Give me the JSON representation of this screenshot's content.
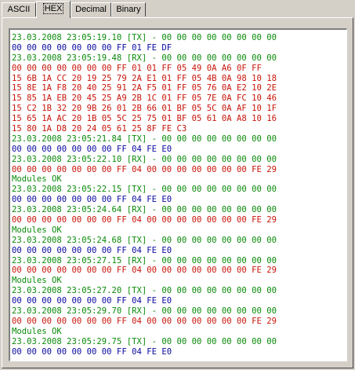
{
  "tabs": [
    {
      "label": "ASCII",
      "active": false
    },
    {
      "label": "HEX",
      "active": true
    },
    {
      "label": "Decimal",
      "active": false
    },
    {
      "label": "Binary",
      "active": false
    }
  ],
  "colors": {
    "tx_header": "#0a8a0a",
    "rx": "#c8140a",
    "tx_data": "#0a0aa0",
    "status_ok": "#0a8a0a"
  },
  "log_lines": [
    {
      "type": "tx",
      "text": "23.03.2008 23:05:19.10 [TX] - 00 00 00 00 00 00 00 00"
    },
    {
      "type": "txdata",
      "text": "00 00 00 00 00 00 00 FF 01 FE DF"
    },
    {
      "type": "tx",
      "text": "23.03.2008 23:05:19.48 [RX] - 00 00 00 00 00 00 00 00"
    },
    {
      "type": "rx",
      "text": "00 00 00 00 00 00 00 FF 01 01 FF 05 49 0A A6 0F FF"
    },
    {
      "type": "rx",
      "text": "15 6B 1A CC 20 19 25 79 2A E1 01 FF 05 4B 0A 98 10 18"
    },
    {
      "type": "rx",
      "text": "15 8E 1A F8 20 40 25 91 2A F5 01 FF 05 76 0A E2 10 2E"
    },
    {
      "type": "rx",
      "text": "15 85 1A EB 20 45 25 A9 2B 1C 01 FF 05 7E 0A FC 10 46"
    },
    {
      "type": "rx",
      "text": "15 C2 1B 32 20 9B 26 01 2B 66 01 BF 05 5C 0A AF 10 1F"
    },
    {
      "type": "rx",
      "text": "15 65 1A AC 20 1B 05 5C 25 75 01 BF 05 61 0A A8 10 16"
    },
    {
      "type": "rx",
      "text": "15 80 1A D8 20 24 05 61 25 8F FE C3"
    },
    {
      "type": "tx",
      "text": "23.03.2008 23:05:21.84 [TX] - 00 00 00 00 00 00 00 00"
    },
    {
      "type": "txdata",
      "text": "00 00 00 00 00 00 00 FF 04 FE E0"
    },
    {
      "type": "tx",
      "text": "23.03.2008 23:05:22.10 [RX] - 00 00 00 00 00 00 00 00"
    },
    {
      "type": "rx",
      "text": "00 00 00 00 00 00 00 FF 04 00 00 00 00 00 00 00 FE 29"
    },
    {
      "type": "ok",
      "text": "Modules OK"
    },
    {
      "type": "tx",
      "text": "23.03.2008 23:05:22.15 [TX] - 00 00 00 00 00 00 00 00"
    },
    {
      "type": "txdata",
      "text": "00 00 00 00 00 00 00 FF 04 FE E0"
    },
    {
      "type": "tx",
      "text": "23.03.2008 23:05:24.64 [RX] - 00 00 00 00 00 00 00 00"
    },
    {
      "type": "rx",
      "text": "00 00 00 00 00 00 00 FF 04 00 00 00 00 00 00 00 FE 29"
    },
    {
      "type": "ok",
      "text": "Modules OK"
    },
    {
      "type": "tx",
      "text": "23.03.2008 23:05:24.68 [TX] - 00 00 00 00 00 00 00 00"
    },
    {
      "type": "txdata",
      "text": "00 00 00 00 00 00 00 FF 04 FE E0"
    },
    {
      "type": "tx",
      "text": "23.03.2008 23:05:27.15 [RX] - 00 00 00 00 00 00 00 00"
    },
    {
      "type": "rx",
      "text": "00 00 00 00 00 00 00 FF 04 00 00 00 00 00 00 00 FE 29"
    },
    {
      "type": "ok",
      "text": "Modules OK"
    },
    {
      "type": "tx",
      "text": "23.03.2008 23:05:27.20 [TX] - 00 00 00 00 00 00 00 00"
    },
    {
      "type": "txdata",
      "text": "00 00 00 00 00 00 00 FF 04 FE E0"
    },
    {
      "type": "tx",
      "text": "23.03.2008 23:05:29.70 [RX] - 00 00 00 00 00 00 00 00"
    },
    {
      "type": "rx",
      "text": "00 00 00 00 00 00 00 FF 04 00 00 00 00 00 00 00 FE 29"
    },
    {
      "type": "ok",
      "text": "Modules OK"
    },
    {
      "type": "tx",
      "text": "23.03.2008 23:05:29.75 [TX] - 00 00 00 00 00 00 00 00"
    },
    {
      "type": "txdata",
      "text": "00 00 00 00 00 00 00 FF 04 FE E0"
    }
  ]
}
